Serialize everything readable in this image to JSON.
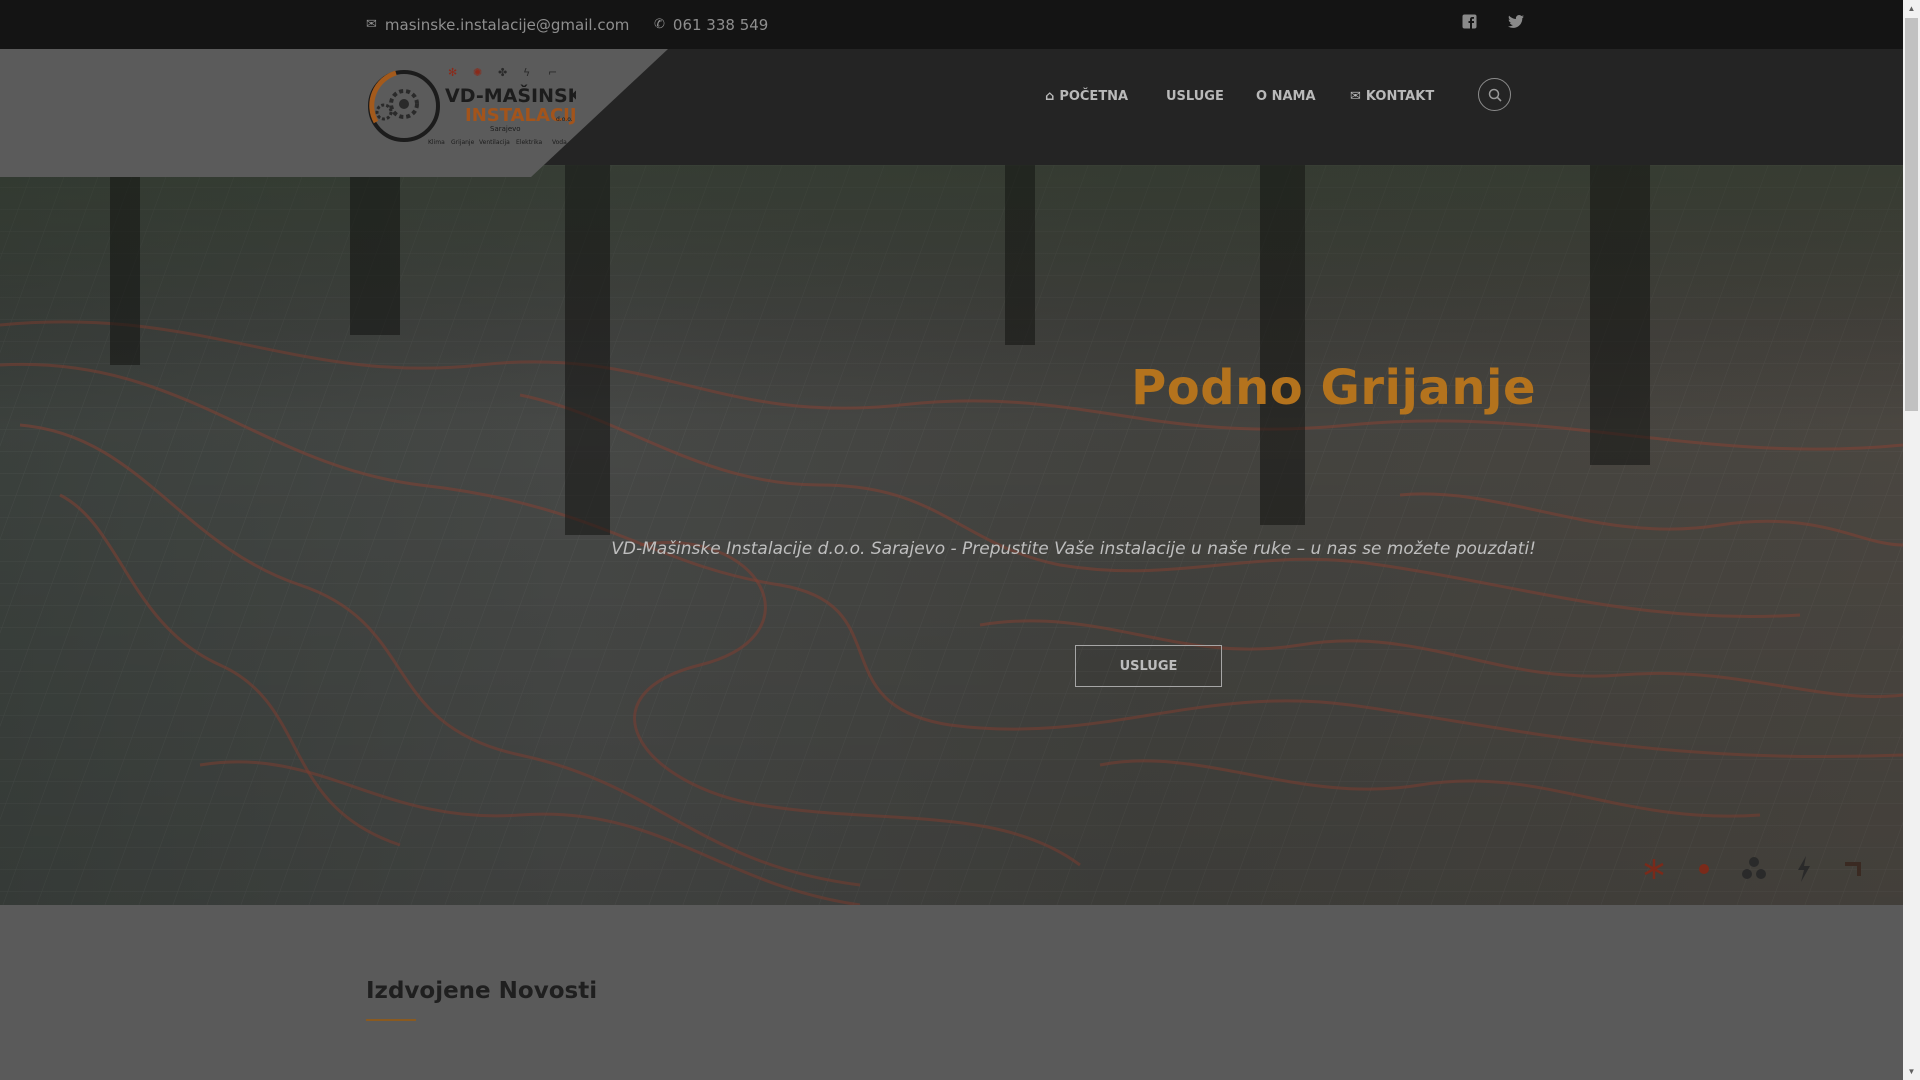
{
  "topbar": {
    "email": "masinske.instalacije@gmail.com",
    "phone": "061 338 549",
    "social": [
      "facebook-icon",
      "twitter-icon"
    ]
  },
  "logo": {
    "name_line1": "VD-MAŠINSKE",
    "name_line2": "INSTALACIJE",
    "suffix": "d.o.o.",
    "city": "Sarajevo",
    "services": [
      "Klima",
      "Grijanje",
      "Ventilacija",
      "Elektrika",
      "Voda"
    ]
  },
  "nav": {
    "home": "POČETNA",
    "services": "USLUGE",
    "about": "O NAMA",
    "contact": "KONTAKT"
  },
  "hero": {
    "title": "Podno Grijanje",
    "subtitle": "VD-Mašinske Instalacije d.o.o. Sarajevo - Prepustite Vaše instalacije u naše ruke – u nas se možete pouzdati!",
    "button": "USLUGE"
  },
  "news": {
    "title": "Izdvojene Novosti"
  },
  "colors": {
    "accent": "#b4731d",
    "topbar_bg": "#141414",
    "header_bg": "#242424"
  }
}
